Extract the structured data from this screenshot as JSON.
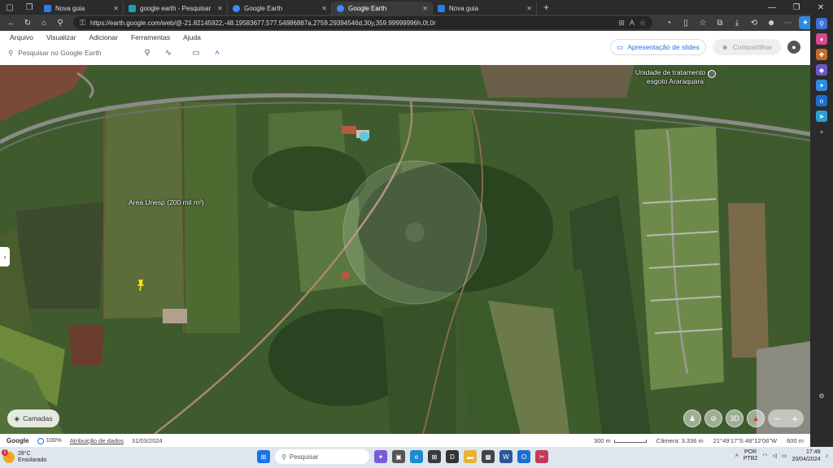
{
  "browser": {
    "tabs": [
      {
        "label": "Nova guia",
        "color": "#2b7de9"
      },
      {
        "label": "google earth - Pesquisar",
        "color": "#1aa1b3"
      },
      {
        "label": "Google Earth",
        "color": "#4285f4"
      },
      {
        "label": "Google Earth",
        "color": "#4285f4"
      },
      {
        "label": "Nova guia",
        "color": "#2b7de9"
      }
    ],
    "active_tab_index": 3,
    "url": "https://earth.google.com/web/@-21.82145922,-48.19583677,577.54986887a,2759.29394546d,30y,359.99999996h,0t,0r"
  },
  "earth": {
    "menu": [
      "Arquivo",
      "Visualizar",
      "Adicionar",
      "Ferramentas",
      "Ajuda"
    ],
    "search_placeholder": "Pesquisar no Google Earth",
    "slideshow_label": "Apresentação de slides",
    "share_label": "Compartilhar",
    "layers_label": "Camadas",
    "view_3d_label": "3D",
    "place_labels": [
      {
        "text": "Área Unesp (200 mil m²)"
      },
      {
        "text": "Unidade de tratamento de esgoto Araraquara"
      }
    ]
  },
  "status": {
    "google": "Google",
    "zoom": "100%",
    "data_attribution": "Atribuição de dados",
    "date": "31/03/2024",
    "scale": "300 m",
    "camera": "Câmera: 3.336 m",
    "coords": "21°49'17\"S 48°12'06\"W",
    "elevation": "600 m"
  },
  "taskbar": {
    "weather_temp": "28°C",
    "weather_desc": "Ensolarado",
    "notification_count": "1",
    "search_placeholder": "Pesquisar",
    "lang_1": "POR",
    "lang_2": "PTB2",
    "time": "17:48",
    "date": "20/04/2024"
  },
  "colors": {
    "accent": "#1a73e8",
    "terrain": "#3e5a2c"
  }
}
